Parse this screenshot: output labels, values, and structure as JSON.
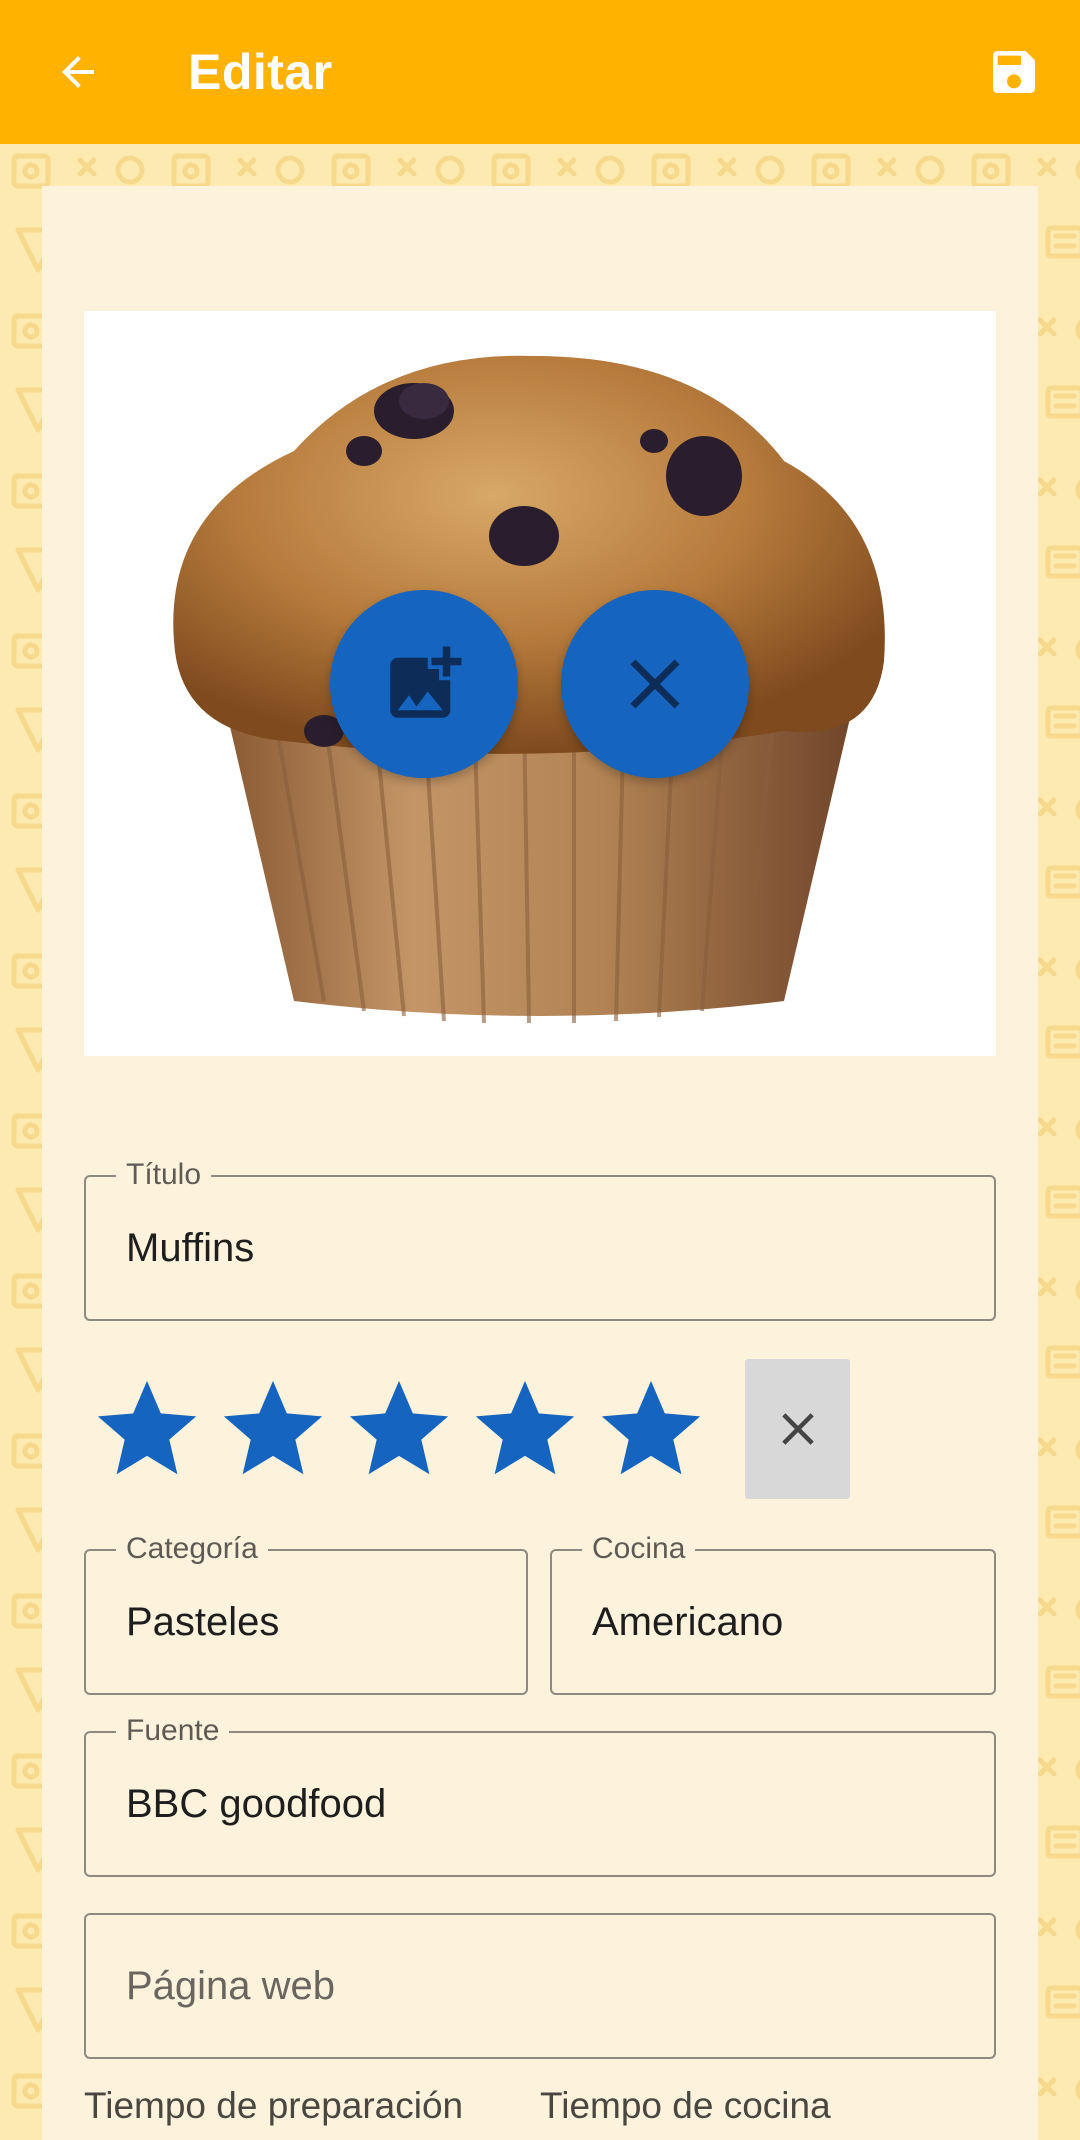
{
  "app_bar": {
    "title": "Editar",
    "back_icon": "arrow-left-icon",
    "save_icon": "floppy-save-icon",
    "background_color": "#FFB300"
  },
  "photo": {
    "subject": "muffin",
    "add_photo_icon": "add-photo-icon",
    "remove_photo_icon": "close-icon",
    "fab_color": "#1565C0"
  },
  "form": {
    "title": {
      "label": "Título",
      "value": "Muffins"
    },
    "rating": {
      "value": 5,
      "max": 5,
      "star_color": "#1565C0",
      "clear_icon": "close-icon"
    },
    "category": {
      "label": "Categoría",
      "value": "Pasteles"
    },
    "cuisine": {
      "label": "Cocina",
      "value": "Americano"
    },
    "source": {
      "label": "Fuente",
      "value": "BBC goodfood"
    },
    "website": {
      "placeholder": "Página web",
      "value": ""
    },
    "prep_time_label": "Tiempo de preparación",
    "cook_time_label": "Tiempo de cocina"
  }
}
